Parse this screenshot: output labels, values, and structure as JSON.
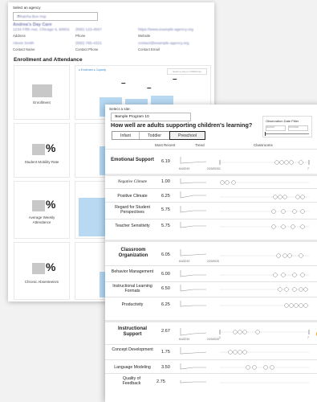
{
  "agency": {
    "label": "Select an agency",
    "selected": "Whatcha Boo Hop",
    "name_line": "Andrea's Day Care",
    "address_line": "1234 Fifth Ave, Chicago IL 60601",
    "address_label": "Address",
    "phone_value": "(555) 123-4567",
    "phone_label": "Phone",
    "website_value": "https://www.example-agency.org",
    "website_label": "Website",
    "contact_name_value": "Alexis Smith",
    "contact_name_label": "Contact Name",
    "contact_phone_value": "(555) 765-4321",
    "contact_phone_label": "Contact Phone",
    "contact_email_value": "contact@example-agency.org",
    "contact_email_label": "Contact Email"
  },
  "enrollment": {
    "title": "Enrollment and Attendance",
    "legend": "● Enrollment ● Capacity",
    "filter_placeholder": "Select a site to CORE/impt",
    "metrics": [
      {
        "label": "Enrollment",
        "sign": ""
      },
      {
        "label": "Student Mobility Rate",
        "sign": "%"
      },
      {
        "label": "Average Weekly Attendance",
        "sign": "%"
      },
      {
        "label": "Chronic Absenteeism",
        "sign": "%"
      }
    ],
    "dashes": [
      "–",
      "–",
      "–"
    ]
  },
  "site": {
    "label": "Select a site:",
    "selected": "Sample Program 10",
    "question": "How well are adults supporting children's learning?",
    "tabs": [
      "Infant",
      "Toddler",
      "Preschool"
    ],
    "active_tab": "Preschool"
  },
  "observation_filter": {
    "title": "Observation Date Filter",
    "start": "9/1/2017",
    "end": "3/17/2020"
  },
  "columns": {
    "most_recent": "Most Recent",
    "trend": "Trend",
    "classrooms": "Classrooms"
  },
  "trend_dates": {
    "start": "6/4/2019",
    "end": "2/20/2020"
  },
  "axis_min": "1",
  "axis_max": "7",
  "domains": [
    {
      "name": "Emotional Support",
      "score": "6.19",
      "dimensions": [
        {
          "name": "Negative Climate",
          "score": "1.00"
        },
        {
          "name": "Positive Climate",
          "score": "6.25"
        },
        {
          "name": "Regard for Student Perspectives",
          "score": "5.75"
        },
        {
          "name": "Teacher Sensitivity",
          "score": "5.75"
        }
      ]
    },
    {
      "name": "Classroom Organization",
      "score": "6.05",
      "dimensions": [
        {
          "name": "Behavior Management",
          "score": "6.00"
        },
        {
          "name": "Instructional Learning Formats",
          "score": "6.50"
        },
        {
          "name": "Productivity",
          "score": "6.25"
        }
      ]
    },
    {
      "name": "Instructional Support",
      "score": "2.67",
      "dimensions": [
        {
          "name": "Concept Development",
          "score": "1.75"
        },
        {
          "name": "Language Modeling",
          "score": "3.50"
        },
        {
          "name": "Quality of Feedback",
          "score": "2.75"
        }
      ]
    }
  ],
  "colors": {
    "bar_fill": "#b7d9f2",
    "accent_orange": "#f2a21b",
    "placeholder_gray": "#c8c8c8"
  }
}
